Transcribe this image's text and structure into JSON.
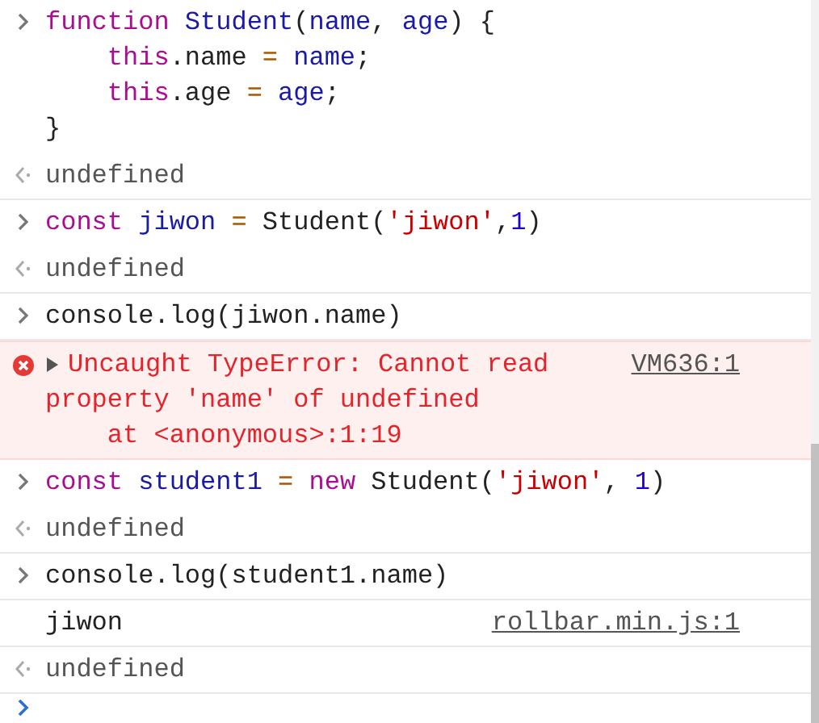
{
  "console": {
    "entries": [
      {
        "kind": "input",
        "lines": [
          [
            {
              "text": "function ",
              "kind": "keyword"
            },
            {
              "text": "Student",
              "kind": "def"
            },
            {
              "text": "(",
              "kind": "plain"
            },
            {
              "text": "name",
              "kind": "def"
            },
            {
              "text": ", ",
              "kind": "plain"
            },
            {
              "text": "age",
              "kind": "def"
            },
            {
              "text": ") {",
              "kind": "plain"
            }
          ],
          [
            {
              "text": "    this",
              "kind": "keyword"
            },
            {
              "text": ".name ",
              "kind": "plain"
            },
            {
              "text": "= ",
              "kind": "operator"
            },
            {
              "text": "name",
              "kind": "def"
            },
            {
              "text": ";",
              "kind": "plain"
            }
          ],
          [
            {
              "text": "    this",
              "kind": "keyword"
            },
            {
              "text": ".age ",
              "kind": "plain"
            },
            {
              "text": "= ",
              "kind": "operator"
            },
            {
              "text": "age",
              "kind": "def"
            },
            {
              "text": ";",
              "kind": "plain"
            }
          ],
          [
            {
              "text": "}",
              "kind": "plain"
            }
          ]
        ]
      },
      {
        "kind": "result",
        "text": "undefined"
      },
      {
        "kind": "input",
        "lines": [
          [
            {
              "text": "const ",
              "kind": "keyword"
            },
            {
              "text": "jiwon ",
              "kind": "def"
            },
            {
              "text": "=",
              "kind": "operator"
            },
            {
              "text": " Student(",
              "kind": "plain"
            },
            {
              "text": "'jiwon'",
              "kind": "string"
            },
            {
              "text": ",",
              "kind": "plain"
            },
            {
              "text": "1",
              "kind": "number"
            },
            {
              "text": ")",
              "kind": "plain"
            }
          ]
        ]
      },
      {
        "kind": "result",
        "text": "undefined"
      },
      {
        "kind": "input",
        "lines": [
          [
            {
              "text": "console.log(jiwon.name)",
              "kind": "plain"
            }
          ]
        ]
      },
      {
        "kind": "error",
        "expanded": false,
        "lines": [
          "Uncaught TypeError: Cannot read",
          "property 'name' of undefined",
          "    at <anonymous>:1:19"
        ],
        "source": "VM636:1"
      },
      {
        "kind": "input",
        "lines": [
          [
            {
              "text": "const ",
              "kind": "keyword"
            },
            {
              "text": "student1 ",
              "kind": "def"
            },
            {
              "text": "= ",
              "kind": "operator"
            },
            {
              "text": "new",
              "kind": "keyword"
            },
            {
              "text": " Student(",
              "kind": "plain"
            },
            {
              "text": "'jiwon'",
              "kind": "string"
            },
            {
              "text": ", ",
              "kind": "plain"
            },
            {
              "text": "1",
              "kind": "number"
            },
            {
              "text": ")",
              "kind": "plain"
            }
          ]
        ]
      },
      {
        "kind": "result",
        "text": "undefined"
      },
      {
        "kind": "input",
        "lines": [
          [
            {
              "text": "console.log(student1.name)",
              "kind": "plain"
            }
          ]
        ]
      },
      {
        "kind": "log",
        "text": "jiwon",
        "source": "rollbar.min.js:1"
      },
      {
        "kind": "result",
        "text": "undefined"
      },
      {
        "kind": "prompt"
      }
    ]
  }
}
